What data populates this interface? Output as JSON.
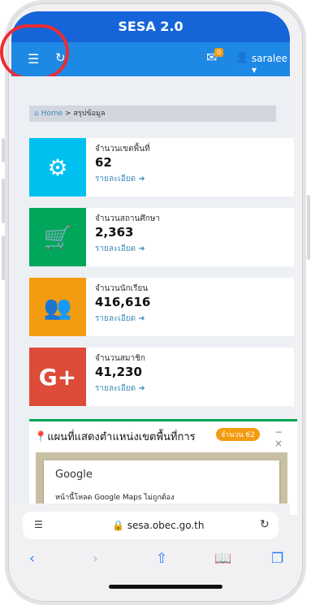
{
  "header": {
    "title": "SESA 2.0"
  },
  "navbar": {
    "menu_icon": "hamburger-icon",
    "refresh_icon": "refresh-icon",
    "mail_icon": "envelope-icon",
    "mail_badge": "0",
    "user_icon": "user-icon",
    "username": "saralee"
  },
  "breadcrumb": {
    "home": "Home",
    "separator": ">",
    "current": "สรุปข้อมูล"
  },
  "cards": [
    {
      "label": "จำนวนเขตพื้นที่",
      "value": "62",
      "more": "รายละเอียด",
      "color": "#00c0ef",
      "icon": "gear-icon"
    },
    {
      "label": "จำนวนสถานศึกษา",
      "value": "2,363",
      "more": "รายละเอียด",
      "color": "#00a65a",
      "icon": "cart-icon"
    },
    {
      "label": "จำนวนนักเรียน",
      "value": "416,616",
      "more": "รายละเอียด",
      "color": "#f39c12",
      "icon": "users-icon"
    },
    {
      "label": "จำนวนสมาชิก",
      "value": "41,230",
      "more": "รายละเอียด",
      "color": "#dd4b39",
      "icon": "google-plus-icon"
    }
  ],
  "map": {
    "title": "แผนที่แสดงตำแหน่งเขตพื้นที่การ",
    "badge": "จำนวน 62",
    "minimize": "−",
    "close": "×",
    "google": "Google",
    "message": "หน้านี้โหลด Google Maps ไม่ถูกต้อง"
  },
  "browser": {
    "url": "sesa.obec.go.th",
    "lock": "🔒"
  }
}
